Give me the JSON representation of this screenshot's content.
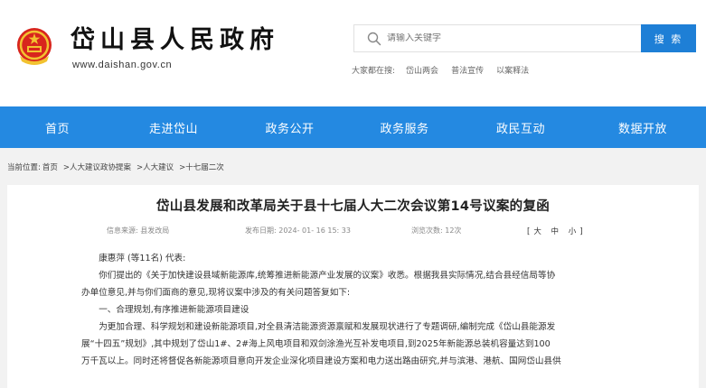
{
  "header": {
    "site_name": "岱山县人民政府",
    "site_url": "www.daishan.gov.cn",
    "search": {
      "placeholder": "请输入关键字",
      "button_label": "搜 索"
    },
    "hot_searches": {
      "label": "大家都在搜:",
      "items": [
        "岱山两会",
        "普法宣传",
        "以案释法"
      ]
    }
  },
  "nav": {
    "items": [
      "首页",
      "走进岱山",
      "政务公开",
      "政务服务",
      "政民互动",
      "数据开放"
    ]
  },
  "breadcrumb": {
    "label": "当前位置:",
    "items": [
      "首页",
      ">人大建议政协提案",
      ">人大建议",
      ">十七届二次"
    ]
  },
  "article": {
    "title": "岱山县发展和改革局关于县十七届人大二次会议第14号议案的复函",
    "meta": {
      "source": "信息来源: 县发改局",
      "date": "发布日期: 2024- 01- 16 15: 33",
      "views": "浏览次数: 12次",
      "font_size": "[大 中 小]"
    },
    "addressee": "康惠萍 (等11名) 代表:",
    "para1_line1": "你们提出的《关于加快建设县域新能源库,统筹推进新能源产业发展的议案》收悉。根据我县实际情况,结合县经信局等协",
    "para1_line2": "办单位意见,并与你们面商的意见,现将议案中涉及的有关问题答复如下:",
    "section1": "一、合理规划,有序推进新能源项目建设",
    "para2_line1": "为更加合理、科学规划和建设新能源项目,对全县清洁能源资源禀赋和发展现状进行了专题调研,编制完成《岱山县能源发",
    "para2_line2": "展“十四五”规划》,其中规划了岱山1#、2#海上风电项目和双剑涂渔光互补发电项目,到2025年新能源总装机容量达到100",
    "para2_line3": "万千瓦以上。同时还将督促各新能源项目意向开发企业深化项目建设方案和电力送出路由研究,并与滨港、港航、国网岱山县供"
  },
  "colors": {
    "nav_bg": "#2489e1",
    "search_button": "#1e7fd6",
    "page_bg": "#f2f2f2"
  }
}
